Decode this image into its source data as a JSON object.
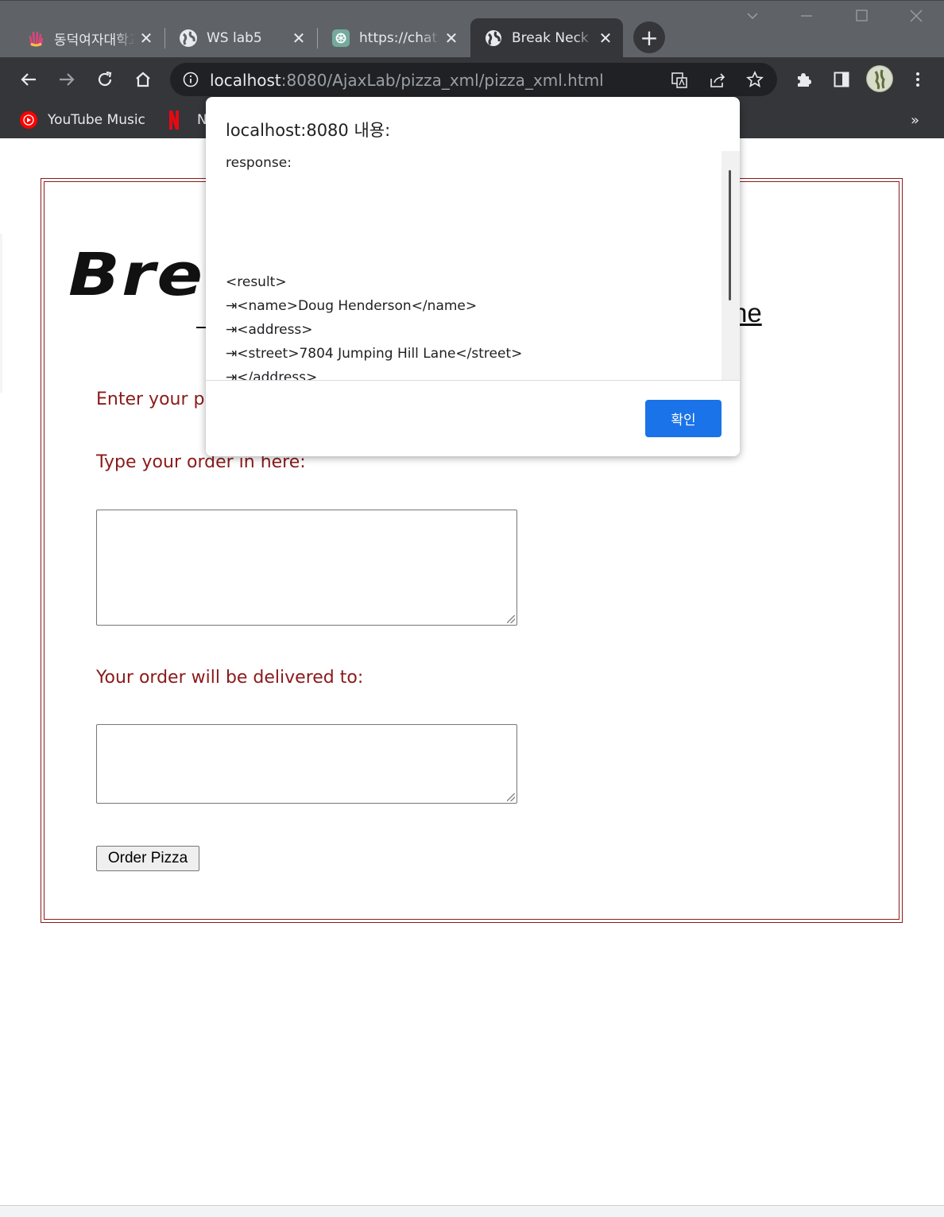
{
  "browser": {
    "tabs": [
      {
        "label": "동덕여자대학교",
        "active": false
      },
      {
        "label": "WS lab5",
        "active": false
      },
      {
        "label": "https://chat.openai.com",
        "active": false
      },
      {
        "label": "Break Neck Pizza",
        "active": true
      }
    ],
    "tab_close_glyph": "✕",
    "new_tab_glyph": "+",
    "url_host": "localhost",
    "url_rest": ":8080/AjaxLab/pizza_xml/pizza_xml.html",
    "bookmarks": [
      {
        "label": "YouTube Music"
      },
      {
        "label": "N"
      }
    ],
    "bookmarks_more": "»"
  },
  "page": {
    "logo_text": "Brea",
    "phone_label": "Enter your pl",
    "order_label": "Type your order in here:",
    "deliver_label": "Your order will be delivered to:",
    "order_button": "Order Pizza",
    "right_fragment": "ne"
  },
  "dialog": {
    "title": "localhost:8080 내용:",
    "message": "response:\n\n\n\n\n<result>\n⇥<name>Doug Henderson</name>\n⇥<address>\n⇥<street>7804 Jumping Hill Lane</street>\n⇥</address>",
    "ok_label": "확인"
  },
  "colors": {
    "accent_red": "#8b1a1a",
    "dialog_button": "#1a73e8"
  }
}
